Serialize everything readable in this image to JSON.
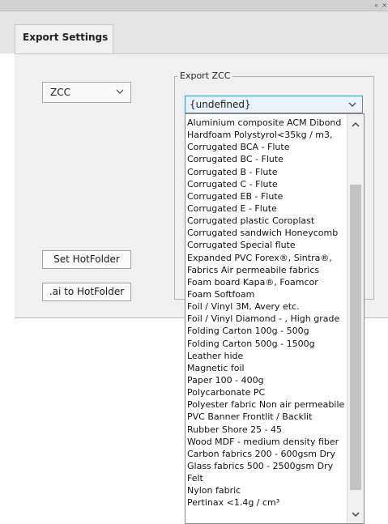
{
  "topbar": {
    "controls": "«  ×"
  },
  "tab": {
    "label": "Export Settings"
  },
  "left": {
    "format_select": {
      "value": "ZCC"
    },
    "set_hotfolder_label": "Set HotFolder",
    "ai_to_hotfolder_label": ".ai to HotFolder"
  },
  "export_group": {
    "title": "Export ZCC",
    "combo_value": "{undefined}",
    "options": [
      "Aluminium composite ACM Dibond",
      "Hardfoam Polystyrol<35kg / m3,",
      "Corrugated BCA - Flute",
      "Corrugated BC - Flute",
      "Corrugated B - Flute",
      "Corrugated C - Flute",
      "Corrugated EB - Flute",
      "Corrugated E - Flute",
      "Corrugated plastic Coroplast",
      "Corrugated sandwich Honeycomb",
      "Corrugated Special flute",
      "Expanded PVC Forex®, Sintra®,",
      "Fabrics Air permeabile fabrics",
      "Foam board Kapa®, Foamcor",
      "Foam Softfoam",
      "Foil / Vinyl 3M, Avery etc.",
      "Foil / Vinyl Diamond - , High grade",
      "Folding Carton 100g - 500g",
      "Folding Carton 500g - 1500g",
      "Leather hide",
      "Magnetic foil",
      "Paper 100 - 400g",
      "Polycarbonate PC",
      "Polyester fabric Non air permeabile",
      "PVC Banner Frontlit / Backlit",
      "Rubber Shore 25 - 45",
      "Wood MDF - medium density fiber",
      "Carbon fabrics 200 - 600gsm Dry",
      "Glass fabrics 500 - 2500gsm Dry",
      "Felt",
      "Nylon fabric",
      "Pertinax <1.4g / cm³"
    ]
  }
}
